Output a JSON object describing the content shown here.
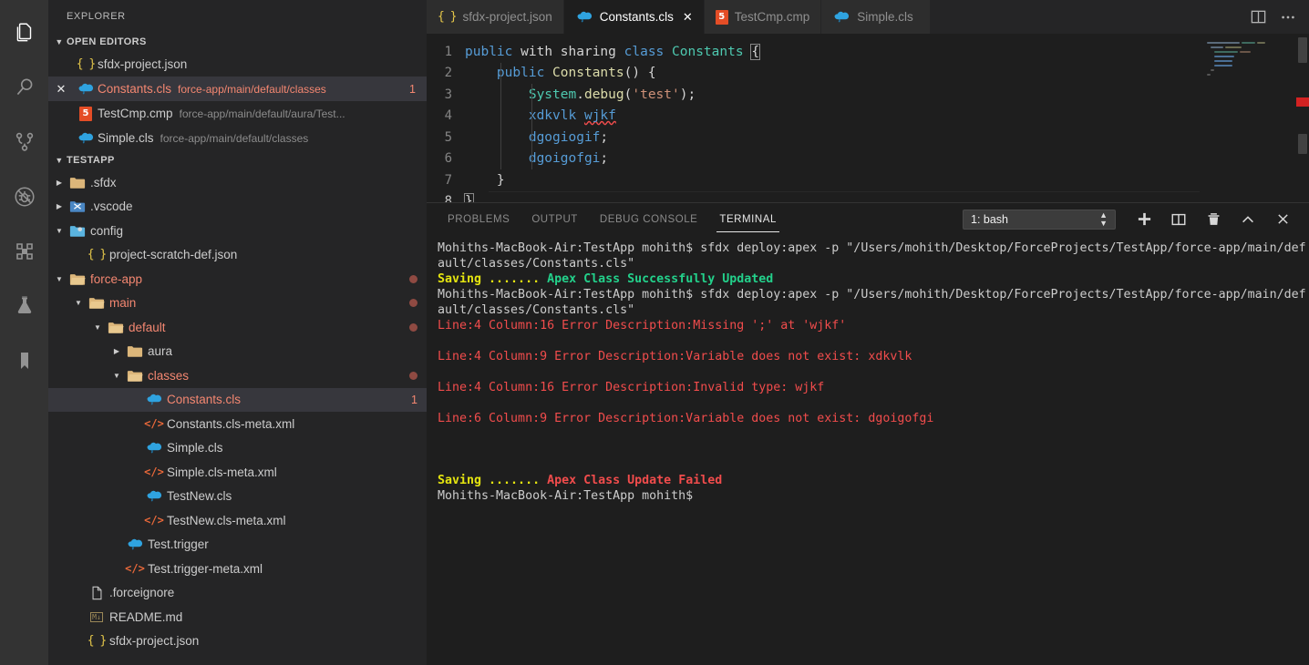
{
  "activitybar": {
    "items": [
      {
        "name": "explorer",
        "icon": "files-icon",
        "active": true
      },
      {
        "name": "search",
        "icon": "search-icon",
        "active": false
      },
      {
        "name": "source-control",
        "icon": "source-control-icon",
        "active": false
      },
      {
        "name": "run-and-debug",
        "icon": "no-debug-icon",
        "active": false
      },
      {
        "name": "extensions",
        "icon": "extensions-icon",
        "active": false
      },
      {
        "name": "testing",
        "icon": "beaker-icon",
        "active": false
      },
      {
        "name": "bookmarks",
        "icon": "bookmark-icon",
        "active": false
      }
    ]
  },
  "sidebar": {
    "title": "EXPLORER",
    "open_editors": {
      "header": "OPEN EDITORS",
      "items": [
        {
          "icon": "json-icon",
          "name": "sfdx-project.json",
          "description": "",
          "badge": "",
          "selected": false,
          "closeable": false,
          "error": false
        },
        {
          "icon": "apex-cloud-icon",
          "name": "Constants.cls",
          "description": "force-app/main/default/classes",
          "badge": "1",
          "selected": true,
          "closeable": true,
          "error": true
        },
        {
          "icon": "html5-icon",
          "name": "TestCmp.cmp",
          "description": "force-app/main/default/aura/Test...",
          "badge": "",
          "selected": false,
          "closeable": false,
          "error": false
        },
        {
          "icon": "apex-cloud-icon",
          "name": "Simple.cls",
          "description": "force-app/main/default/classes",
          "badge": "",
          "selected": false,
          "closeable": false,
          "error": false
        }
      ]
    },
    "project": {
      "header": "TESTAPP",
      "items": [
        {
          "label": ".sfdx",
          "icon": "folder-icon",
          "indent": 1,
          "twisty": "collapsed",
          "error": false,
          "dot": false,
          "badge": "",
          "selected": false
        },
        {
          "label": ".vscode",
          "icon": "vscode-folder-icon",
          "indent": 1,
          "twisty": "collapsed",
          "error": false,
          "dot": false,
          "badge": "",
          "selected": false
        },
        {
          "label": "config",
          "icon": "config-folder-icon",
          "indent": 1,
          "twisty": "expanded",
          "error": false,
          "dot": false,
          "badge": "",
          "selected": false
        },
        {
          "label": "project-scratch-def.json",
          "icon": "json-icon",
          "indent": 2,
          "twisty": "none",
          "error": false,
          "dot": false,
          "badge": "",
          "selected": false
        },
        {
          "label": "force-app",
          "icon": "folder-open-icon",
          "indent": 1,
          "twisty": "expanded",
          "error": true,
          "dot": true,
          "badge": "",
          "selected": false
        },
        {
          "label": "main",
          "icon": "folder-open-icon",
          "indent": 2,
          "twisty": "expanded",
          "error": true,
          "dot": true,
          "badge": "",
          "selected": false
        },
        {
          "label": "default",
          "icon": "folder-open-icon",
          "indent": 3,
          "twisty": "expanded",
          "error": true,
          "dot": true,
          "badge": "",
          "selected": false
        },
        {
          "label": "aura",
          "icon": "folder-icon",
          "indent": 4,
          "twisty": "collapsed",
          "error": false,
          "dot": false,
          "badge": "",
          "selected": false
        },
        {
          "label": "classes",
          "icon": "folder-open-icon",
          "indent": 4,
          "twisty": "expanded",
          "error": true,
          "dot": true,
          "badge": "",
          "selected": false
        },
        {
          "label": "Constants.cls",
          "icon": "apex-cloud-icon",
          "indent": 5,
          "twisty": "none",
          "error": true,
          "dot": false,
          "badge": "1",
          "selected": true
        },
        {
          "label": "Constants.cls-meta.xml",
          "icon": "xml-icon",
          "indent": 5,
          "twisty": "none",
          "error": false,
          "dot": false,
          "badge": "",
          "selected": false
        },
        {
          "label": "Simple.cls",
          "icon": "apex-cloud-icon",
          "indent": 5,
          "twisty": "none",
          "error": false,
          "dot": false,
          "badge": "",
          "selected": false
        },
        {
          "label": "Simple.cls-meta.xml",
          "icon": "xml-icon",
          "indent": 5,
          "twisty": "none",
          "error": false,
          "dot": false,
          "badge": "",
          "selected": false
        },
        {
          "label": "TestNew.cls",
          "icon": "apex-cloud-icon",
          "indent": 5,
          "twisty": "none",
          "error": false,
          "dot": false,
          "badge": "",
          "selected": false
        },
        {
          "label": "TestNew.cls-meta.xml",
          "icon": "xml-icon",
          "indent": 5,
          "twisty": "none",
          "error": false,
          "dot": false,
          "badge": "",
          "selected": false
        },
        {
          "label": "Test.trigger",
          "icon": "apex-cloud-icon",
          "indent": 4,
          "twisty": "none",
          "error": false,
          "dot": false,
          "badge": "",
          "selected": false
        },
        {
          "label": "Test.trigger-meta.xml",
          "icon": "xml-icon",
          "indent": 4,
          "twisty": "none",
          "error": false,
          "dot": false,
          "badge": "",
          "selected": false
        },
        {
          "label": ".forceignore",
          "icon": "file-icon",
          "indent": 2,
          "twisty": "none",
          "error": false,
          "dot": false,
          "badge": "",
          "selected": false
        },
        {
          "label": "README.md",
          "icon": "markdown-icon",
          "indent": 2,
          "twisty": "none",
          "error": false,
          "dot": false,
          "badge": "",
          "selected": false
        },
        {
          "label": "sfdx-project.json",
          "icon": "json-icon",
          "indent": 2,
          "twisty": "none",
          "error": false,
          "dot": false,
          "badge": "",
          "selected": false
        }
      ]
    }
  },
  "tabs": {
    "items": [
      {
        "label": "sfdx-project.json",
        "icon": "json-icon",
        "active": false,
        "closeable": false
      },
      {
        "label": "Constants.cls",
        "icon": "apex-cloud-icon",
        "active": true,
        "closeable": true
      },
      {
        "label": "TestCmp.cmp",
        "icon": "html5-icon",
        "active": false,
        "closeable": false
      },
      {
        "label": "Simple.cls",
        "icon": "apex-cloud-icon",
        "active": false,
        "closeable": false
      }
    ],
    "actions": [
      {
        "name": "split-editor-icon",
        "label": "Split Editor"
      },
      {
        "name": "more-actions-icon",
        "label": "More Actions..."
      }
    ]
  },
  "editor": {
    "file": "Constants.cls",
    "current_line": 8,
    "lines": [
      {
        "n": "1",
        "tokens": [
          {
            "t": "public",
            "c": "kw"
          },
          {
            "t": " ",
            "c": "plain"
          },
          {
            "t": "with sharing",
            "c": "plain"
          },
          {
            "t": " ",
            "c": "plain"
          },
          {
            "t": "class",
            "c": "kw"
          },
          {
            "t": " ",
            "c": "plain"
          },
          {
            "t": "Constants",
            "c": "type"
          },
          {
            "t": " ",
            "c": "plain"
          },
          {
            "t": "{",
            "c": "box"
          }
        ]
      },
      {
        "n": "2",
        "tokens": [
          {
            "t": "    ",
            "c": "plain"
          },
          {
            "t": "public",
            "c": "kw"
          },
          {
            "t": " ",
            "c": "plain"
          },
          {
            "t": "Constants",
            "c": "fn"
          },
          {
            "t": "() {",
            "c": "plain"
          }
        ]
      },
      {
        "n": "3",
        "tokens": [
          {
            "t": "        ",
            "c": "plain"
          },
          {
            "t": "System",
            "c": "type"
          },
          {
            "t": ".",
            "c": "plain"
          },
          {
            "t": "debug",
            "c": "fn"
          },
          {
            "t": "(",
            "c": "plain"
          },
          {
            "t": "'test'",
            "c": "str"
          },
          {
            "t": ");",
            "c": "plain"
          }
        ]
      },
      {
        "n": "4",
        "tokens": [
          {
            "t": "        ",
            "c": "plain"
          },
          {
            "t": "xdkvlk",
            "c": "kw"
          },
          {
            "t": " ",
            "c": "plain"
          },
          {
            "t": "wjkf",
            "c": "kw-squiggle"
          }
        ]
      },
      {
        "n": "5",
        "tokens": [
          {
            "t": "        ",
            "c": "plain"
          },
          {
            "t": "dgogiogif",
            "c": "kw"
          },
          {
            "t": ";",
            "c": "plain"
          }
        ]
      },
      {
        "n": "6",
        "tokens": [
          {
            "t": "        ",
            "c": "plain"
          },
          {
            "t": "dgoigofgi",
            "c": "kw"
          },
          {
            "t": ";",
            "c": "plain"
          }
        ]
      },
      {
        "n": "7",
        "tokens": [
          {
            "t": "    ",
            "c": "plain"
          },
          {
            "t": "}",
            "c": "plain"
          }
        ]
      },
      {
        "n": "8",
        "tokens": [
          {
            "t": "}",
            "c": "box"
          }
        ]
      }
    ]
  },
  "panel": {
    "tabs": [
      {
        "label": "PROBLEMS",
        "active": false
      },
      {
        "label": "OUTPUT",
        "active": false
      },
      {
        "label": "DEBUG CONSOLE",
        "active": false
      },
      {
        "label": "TERMINAL",
        "active": true
      }
    ],
    "terminal_select": {
      "value": "1: bash",
      "options": [
        "1: bash"
      ]
    },
    "actions": [
      {
        "name": "new-terminal-icon",
        "label": "New Terminal"
      },
      {
        "name": "split-terminal-icon",
        "label": "Split Terminal"
      },
      {
        "name": "kill-terminal-icon",
        "label": "Kill Terminal"
      },
      {
        "name": "maximize-panel-icon",
        "label": "Maximize Panel Size"
      },
      {
        "name": "close-panel-icon",
        "label": "Close Panel"
      }
    ],
    "terminal_lines": [
      {
        "segments": [
          {
            "t": "Mohiths-MacBook-Air:TestApp mohith$ sfdx deploy:apex -p \"/Users/mohith/Desktop/ForceProjects/TestApp/force-app/main/default/classes/Constants.cls\"",
            "c": "white"
          }
        ]
      },
      {
        "segments": [
          {
            "t": "Saving .......",
            "c": "yellow"
          },
          {
            "t": " ",
            "c": "white"
          },
          {
            "t": "Apex Class Successfully Updated",
            "c": "green"
          }
        ]
      },
      {
        "segments": [
          {
            "t": "Mohiths-MacBook-Air:TestApp mohith$ sfdx deploy:apex -p \"/Users/mohith/Desktop/ForceProjects/TestApp/force-app/main/default/classes/Constants.cls\"",
            "c": "white"
          }
        ]
      },
      {
        "segments": [
          {
            "t": "Line:4 Column:16 Error Description:Missing ';' at 'wjkf'",
            "c": "red"
          }
        ]
      },
      {
        "segments": [
          {
            "t": "",
            "c": "white"
          }
        ]
      },
      {
        "segments": [
          {
            "t": "Line:4 Column:9 Error Description:Variable does not exist: xdkvlk",
            "c": "red"
          }
        ]
      },
      {
        "segments": [
          {
            "t": "",
            "c": "white"
          }
        ]
      },
      {
        "segments": [
          {
            "t": "Line:4 Column:16 Error Description:Invalid type: wjkf",
            "c": "red"
          }
        ]
      },
      {
        "segments": [
          {
            "t": "",
            "c": "white"
          }
        ]
      },
      {
        "segments": [
          {
            "t": "Line:6 Column:9 Error Description:Variable does not exist: dgoigofgi",
            "c": "red"
          }
        ]
      },
      {
        "segments": [
          {
            "t": "",
            "c": "white"
          }
        ]
      },
      {
        "segments": [
          {
            "t": "",
            "c": "white"
          }
        ]
      },
      {
        "segments": [
          {
            "t": "",
            "c": "white"
          }
        ]
      },
      {
        "segments": [
          {
            "t": "Saving .......",
            "c": "yellow"
          },
          {
            "t": " ",
            "c": "white"
          },
          {
            "t": "Apex Class Update Failed",
            "c": "redbold"
          }
        ]
      },
      {
        "segments": [
          {
            "t": "Mohiths-MacBook-Air:TestApp mohith$",
            "c": "white"
          }
        ]
      }
    ]
  },
  "colors": {
    "accent_error": "#f48771",
    "terminal_red": "#f14c4c",
    "terminal_green": "#23d18b",
    "terminal_yellow": "#e5e510",
    "apex_blue": "#2fa3e0"
  }
}
